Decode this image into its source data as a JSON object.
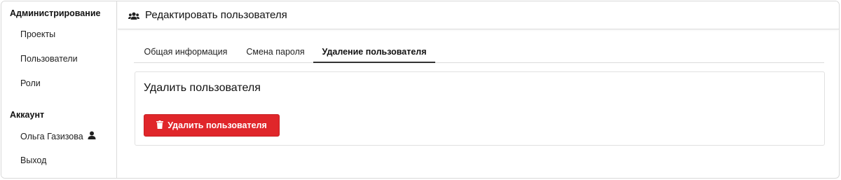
{
  "sidebar": {
    "admin_heading": "Администрирование",
    "admin_items": [
      {
        "label": "Проекты"
      },
      {
        "label": "Пользователи"
      },
      {
        "label": "Роли"
      }
    ],
    "account_heading": "Аккаунт",
    "account_items": [
      {
        "label": "Ольга Газизова",
        "icon": "user-icon"
      },
      {
        "label": "Выход"
      }
    ]
  },
  "header": {
    "icon": "users-icon",
    "title": "Редактировать пользователя"
  },
  "tabs": [
    {
      "label": "Общая информация",
      "active": false
    },
    {
      "label": "Смена пароля",
      "active": false
    },
    {
      "label": "Удаление пользователя",
      "active": true
    }
  ],
  "card": {
    "title": "Удалить пользователя",
    "delete_button": {
      "label": "Удалить пользователя",
      "icon": "trash-icon",
      "color": "#e0262a"
    }
  }
}
